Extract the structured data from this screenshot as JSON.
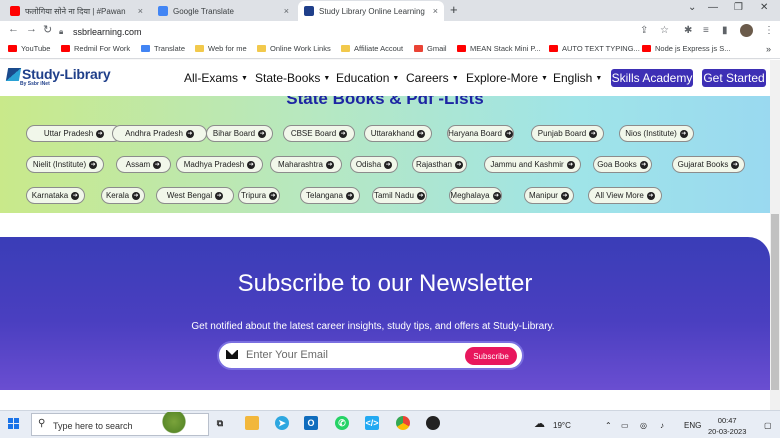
{
  "browser": {
    "tabs": [
      {
        "title": "फलोगिया सोने ना दिया | #Pawan",
        "favicon_color": "#ff0000",
        "active": false
      },
      {
        "title": "Google Translate",
        "favicon_color": "#4285f4",
        "active": false
      },
      {
        "title": "Study Library Online Learning",
        "favicon_color": "#1f3f8a",
        "active": true
      }
    ],
    "close_glyph": "×",
    "new_tab_glyph": "+",
    "url": "ssbrlearning.com",
    "bookmarks": [
      {
        "label": "YouTube",
        "icon_color": "#ff0000"
      },
      {
        "label": "Redmil For Work",
        "icon_color": "#ff0000"
      },
      {
        "label": "Translate",
        "icon_color": "#4285f4"
      },
      {
        "label": "Web for me",
        "icon_color": "#f2c94c"
      },
      {
        "label": "Online Work Links",
        "icon_color": "#f2c94c"
      },
      {
        "label": "Affiliate Accout",
        "icon_color": "#f2c94c"
      },
      {
        "label": "Gmail",
        "icon_color": "#ea4335"
      },
      {
        "label": "MEAN Stack Mini P...",
        "icon_color": "#ff0000"
      },
      {
        "label": "AUTO TEXT TYPING...",
        "icon_color": "#ff0000"
      },
      {
        "label": "Node js Express js S...",
        "icon_color": "#ff0000"
      }
    ],
    "more_bookmarks": "»"
  },
  "site": {
    "logo_text": "Study-Library",
    "logo_tagline": "By Ssbr iNet",
    "nav": [
      "All-Exams",
      "State-Books",
      "Education",
      "Careers",
      "Explore-More",
      "English"
    ],
    "skills_button": "Skills Academy",
    "get_started_button": "Get Started"
  },
  "hero": {
    "title": "State Books & Pdf -Lists",
    "states": [
      "Uttar Pradesh",
      "Andhra Pradesh",
      "Bihar Board",
      "CBSE Board",
      "Uttarakhand",
      "Haryana Board",
      "Punjab Board",
      "Nios (Institute)",
      "Nielit (Institute)",
      "Assam",
      "Madhya Pradesh",
      "Maharashtra",
      "Odisha",
      "Rajasthan",
      "Jammu and Kashmir",
      "Goa Books",
      "Gujarat Books",
      "Karnataka",
      "Kerala",
      "West Bengal",
      "Tripura",
      "Telangana",
      "Tamil Nadu",
      "Meghalaya",
      "Manipur",
      "All View More"
    ]
  },
  "newsletter": {
    "title": "Subscribe to our Newsletter",
    "subtitle": "Get notified about the latest career insights, study tips, and offers at Study-Library.",
    "email_placeholder": "Enter Your Email",
    "subscribe_label": "Subscribe"
  },
  "taskbar": {
    "search_placeholder": "Type here to search",
    "temperature": "19°C",
    "language": "ENG",
    "time": "00:47",
    "date": "20-03-2023"
  }
}
